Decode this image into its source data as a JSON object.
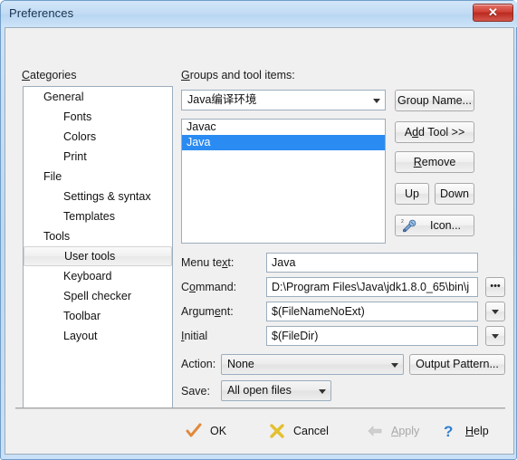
{
  "window": {
    "title": "Preferences",
    "close_icon": "close-x-icon"
  },
  "categories": {
    "label": "Categories",
    "label_mnemonic": "C",
    "items": [
      {
        "label": "General",
        "level": 0,
        "selected": false
      },
      {
        "label": "Fonts",
        "level": 1,
        "selected": false
      },
      {
        "label": "Colors",
        "level": 1,
        "selected": false
      },
      {
        "label": "Print",
        "level": 1,
        "selected": false
      },
      {
        "label": "File",
        "level": 0,
        "selected": false
      },
      {
        "label": "Settings & syntax",
        "level": 1,
        "selected": false
      },
      {
        "label": "Templates",
        "level": 1,
        "selected": false
      },
      {
        "label": "Tools",
        "level": 0,
        "selected": false
      },
      {
        "label": "User tools",
        "level": 1,
        "selected": true
      },
      {
        "label": "Keyboard",
        "level": 1,
        "selected": false
      },
      {
        "label": "Spell checker",
        "level": 1,
        "selected": false
      },
      {
        "label": "Toolbar",
        "level": 1,
        "selected": false
      },
      {
        "label": "Layout",
        "level": 1,
        "selected": false
      }
    ]
  },
  "groups": {
    "label": "Groups and tool items:",
    "label_mnemonic": "G",
    "selected_group": "Java编译环境",
    "tools": [
      {
        "label": "Javac",
        "selected": false
      },
      {
        "label": "Java",
        "selected": true
      }
    ]
  },
  "buttons": {
    "group_name": "Group Name...",
    "add_tool": "Add Tool >>",
    "remove": "Remove",
    "up": "Up",
    "down": "Down",
    "icon": "Icon...",
    "icon_glyph": "wrench-screwdriver-icon",
    "output_pattern": "Output Pattern..."
  },
  "form": {
    "menu_text": {
      "label": "Menu text:",
      "value": "Java"
    },
    "command": {
      "label": "Command:",
      "value": "D:\\Program Files\\Java\\jdk1.8.0_65\\bin\\j",
      "browse_icon": "ellipsis-icon"
    },
    "argument": {
      "label": "Argument:",
      "value": "$(FileNameNoExt)",
      "dropdown_icon": "chevron-down-icon"
    },
    "initial": {
      "label": "Initial",
      "value": "$(FileDir)",
      "dropdown_icon": "chevron-down-icon"
    },
    "action": {
      "label": "Action:",
      "value": "None"
    },
    "save": {
      "label": "Save:",
      "value": "All open files"
    }
  },
  "footer": {
    "ok": {
      "label": "OK",
      "icon": "check-mark-icon",
      "enabled": true
    },
    "cancel": {
      "label": "Cancel",
      "icon": "cross-mark-icon",
      "enabled": true
    },
    "apply": {
      "label": "Apply",
      "icon": "left-arrow-icon",
      "enabled": false
    },
    "help": {
      "label": "Help",
      "icon": "question-mark-icon",
      "enabled": true
    }
  },
  "colors": {
    "selection_blue": "#2a8bf2",
    "titlebar_blue": "#c3dcf4",
    "close_red": "#ba2a20",
    "dialog_gray": "#f0f0f0"
  }
}
